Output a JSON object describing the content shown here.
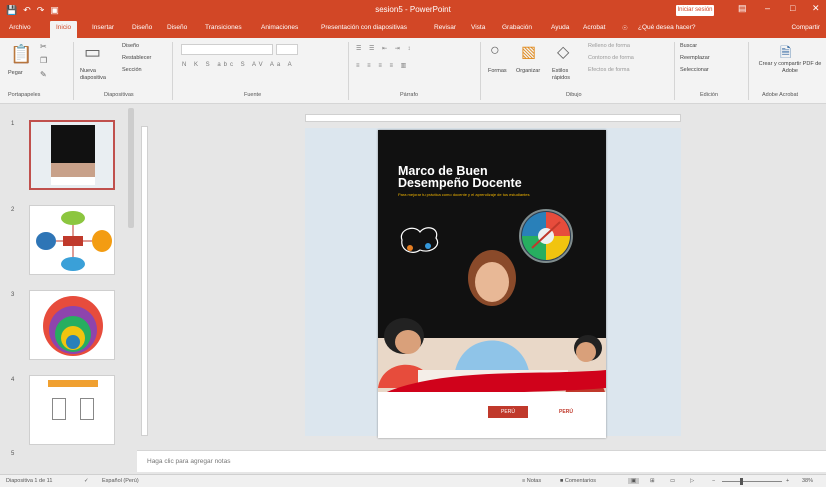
{
  "app": {
    "title": "sesion5 - PowerPoint",
    "signin_label": "Iniciar sesión",
    "share_label": "Compartir"
  },
  "colors": {
    "brand": "#d24726",
    "selection": "#c0504d",
    "slide_backdrop": "#dce6ee"
  },
  "quick_access": {
    "save_icon": "save-icon",
    "undo_icon": "undo-icon",
    "redo_icon": "redo-icon",
    "present_icon": "present-icon"
  },
  "tabs": [
    "Archivo",
    "Inicio",
    "Insertar",
    "Diseño",
    "Diseño",
    "Transiciones",
    "Animaciones",
    "Presentación con diapositivas",
    "Revisar",
    "Vista",
    "Grabación",
    "Ayuda",
    "Acrobat",
    "¿Qué desea hacer?"
  ],
  "ribbon": {
    "clipboard": {
      "paste": "Pegar",
      "label": "Portapapeles"
    },
    "slides": {
      "new_slide": "Nueva diapositiva",
      "layout": "Diseño",
      "reset": "Restablecer",
      "section": "Sección",
      "label": "Diapositivas"
    },
    "font": {
      "label": "Fuente"
    },
    "paragraph": {
      "label": "Párrafo"
    },
    "drawing": {
      "shapes": "Formas",
      "arrange": "Organizar",
      "quick_styles": "Estilos rápidos",
      "fill": "Relleno de forma",
      "outline": "Contorno de forma",
      "effects": "Efectos de forma",
      "label": "Dibujo"
    },
    "editing": {
      "find": "Buscar",
      "replace": "Reemplazar",
      "select": "Seleccionar",
      "label": "Edición"
    },
    "adobe": {
      "create": "Crear y compartir PDF de Adobe",
      "label": "Adobe Acrobat"
    }
  },
  "thumbnails": [
    {
      "number": "1"
    },
    {
      "number": "2"
    },
    {
      "number": "3"
    },
    {
      "number": "4"
    },
    {
      "number": "5"
    }
  ],
  "slide": {
    "title_line1": "Marco de Buen",
    "title_line2": "Desempeño Docente",
    "subtitle": "Para mejorar tu práctica como docente y el aprendizaje de tus estudiantes",
    "logo_left": "PERÚ",
    "logo_right": "PERÚ"
  },
  "notes": {
    "placeholder": "Haga clic para agregar notas"
  },
  "status": {
    "slide_info": "Diapositiva 1 de 11",
    "language": "Español (Perú)",
    "notes_btn": "Notas",
    "comments_btn": "Comentarios",
    "zoom": "38%"
  }
}
